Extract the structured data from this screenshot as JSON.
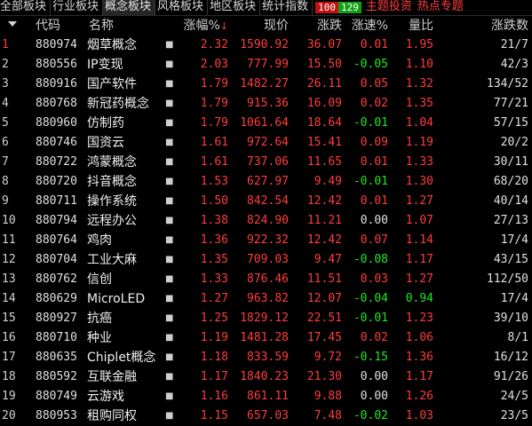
{
  "tabs": [
    {
      "label": "全部板块",
      "active": false
    },
    {
      "label": "行业板块",
      "active": false
    },
    {
      "label": "概念板块",
      "active": true
    },
    {
      "label": "风格板块",
      "active": false
    },
    {
      "label": "地区板块",
      "active": false
    },
    {
      "label": "统计指数",
      "active": false
    }
  ],
  "breadth": {
    "up": "100",
    "down": "129"
  },
  "links": [
    "主题投资",
    "热点专题"
  ],
  "colors": {
    "up": "#ff3c3c",
    "down": "#1ee81e",
    "flat": "#e0e0e0",
    "background": "#000000"
  },
  "header": {
    "sort_icon": "sort-arrow-icon",
    "idx": "",
    "code": "代码",
    "name": "名称",
    "change_pct": "涨幅%",
    "sort_mark": "↓",
    "price": "现价",
    "change": "涨跌",
    "speed": "涨速%",
    "vol_ratio": "量比",
    "up_down_count": "涨跌数"
  },
  "rows": [
    {
      "idx": "1",
      "code": "880974",
      "name": "烟草概念",
      "mark": "■",
      "change_pct": "2.32",
      "price": "1590.92",
      "change": "36.07",
      "speed": "0.01",
      "vol_ratio": "1.95",
      "count": "21/7"
    },
    {
      "idx": "2",
      "code": "880556",
      "name": "IP变现",
      "mark": "■",
      "change_pct": "2.03",
      "price": "777.99",
      "change": "15.50",
      "speed": "-0.05",
      "vol_ratio": "1.10",
      "count": "42/3"
    },
    {
      "idx": "3",
      "code": "880916",
      "name": "国产软件",
      "mark": "■",
      "change_pct": "1.79",
      "price": "1482.27",
      "change": "26.11",
      "speed": "0.05",
      "vol_ratio": "1.32",
      "count": "134/52"
    },
    {
      "idx": "4",
      "code": "880768",
      "name": "新冠药概念",
      "mark": "■",
      "change_pct": "1.79",
      "price": "915.36",
      "change": "16.09",
      "speed": "0.02",
      "vol_ratio": "1.35",
      "count": "77/21"
    },
    {
      "idx": "5",
      "code": "880960",
      "name": "仿制药",
      "mark": "■",
      "change_pct": "1.79",
      "price": "1061.64",
      "change": "18.64",
      "speed": "-0.01",
      "vol_ratio": "1.04",
      "count": "57/15"
    },
    {
      "idx": "6",
      "code": "880746",
      "name": "国资云",
      "mark": "■",
      "change_pct": "1.61",
      "price": "972.64",
      "change": "15.41",
      "speed": "0.09",
      "vol_ratio": "1.19",
      "count": "20/2"
    },
    {
      "idx": "7",
      "code": "880722",
      "name": "鸿蒙概念",
      "mark": "■",
      "change_pct": "1.61",
      "price": "737.06",
      "change": "11.65",
      "speed": "0.01",
      "vol_ratio": "1.33",
      "count": "30/11"
    },
    {
      "idx": "8",
      "code": "880720",
      "name": "抖音概念",
      "mark": "■",
      "change_pct": "1.53",
      "price": "627.97",
      "change": "9.49",
      "speed": "-0.01",
      "vol_ratio": "1.30",
      "count": "68/20"
    },
    {
      "idx": "9",
      "code": "880711",
      "name": "操作系统",
      "mark": "■",
      "change_pct": "1.50",
      "price": "842.54",
      "change": "12.42",
      "speed": "0.01",
      "vol_ratio": "1.27",
      "count": "40/14"
    },
    {
      "idx": "10",
      "code": "880794",
      "name": "远程办公",
      "mark": "■",
      "change_pct": "1.38",
      "price": "824.90",
      "change": "11.21",
      "speed": "0.00",
      "vol_ratio": "1.07",
      "count": "27/13"
    },
    {
      "idx": "11",
      "code": "880764",
      "name": "鸡肉",
      "mark": "■",
      "change_pct": "1.36",
      "price": "922.32",
      "change": "12.42",
      "speed": "0.07",
      "vol_ratio": "1.14",
      "count": "17/4"
    },
    {
      "idx": "12",
      "code": "880704",
      "name": "工业大麻",
      "mark": "■",
      "change_pct": "1.35",
      "price": "709.03",
      "change": "9.47",
      "speed": "-0.08",
      "vol_ratio": "1.17",
      "count": "43/15"
    },
    {
      "idx": "13",
      "code": "880762",
      "name": "信创",
      "mark": "■",
      "change_pct": "1.33",
      "price": "876.46",
      "change": "11.51",
      "speed": "0.03",
      "vol_ratio": "1.27",
      "count": "112/50"
    },
    {
      "idx": "14",
      "code": "880629",
      "name": "MicroLED",
      "mark": "■",
      "change_pct": "1.27",
      "price": "963.82",
      "change": "12.07",
      "speed": "-0.04",
      "vol_ratio": "0.94",
      "count": "17/4"
    },
    {
      "idx": "15",
      "code": "880927",
      "name": "抗癌",
      "mark": "■",
      "change_pct": "1.25",
      "price": "1829.12",
      "change": "22.51",
      "speed": "-0.01",
      "vol_ratio": "1.23",
      "count": "39/10"
    },
    {
      "idx": "16",
      "code": "880710",
      "name": "种业",
      "mark": "■",
      "change_pct": "1.19",
      "price": "1481.28",
      "change": "17.45",
      "speed": "0.02",
      "vol_ratio": "1.06",
      "count": "8/1"
    },
    {
      "idx": "17",
      "code": "880635",
      "name": "Chiplet概念",
      "mark": "■",
      "change_pct": "1.18",
      "price": "833.59",
      "change": "9.72",
      "speed": "-0.15",
      "vol_ratio": "1.36",
      "count": "16/12"
    },
    {
      "idx": "18",
      "code": "880592",
      "name": "互联金融",
      "mark": "■",
      "change_pct": "1.17",
      "price": "1840.23",
      "change": "21.30",
      "speed": "0.00",
      "vol_ratio": "1.17",
      "count": "91/26"
    },
    {
      "idx": "19",
      "code": "880749",
      "name": "云游戏",
      "mark": "■",
      "change_pct": "1.16",
      "price": "861.11",
      "change": "9.88",
      "speed": "0.00",
      "vol_ratio": "1.26",
      "count": "24/5"
    },
    {
      "idx": "20",
      "code": "880953",
      "name": "租购同权",
      "mark": "■",
      "change_pct": "1.15",
      "price": "657.03",
      "change": "7.48",
      "speed": "-0.02",
      "vol_ratio": "1.03",
      "count": "23/5"
    }
  ]
}
